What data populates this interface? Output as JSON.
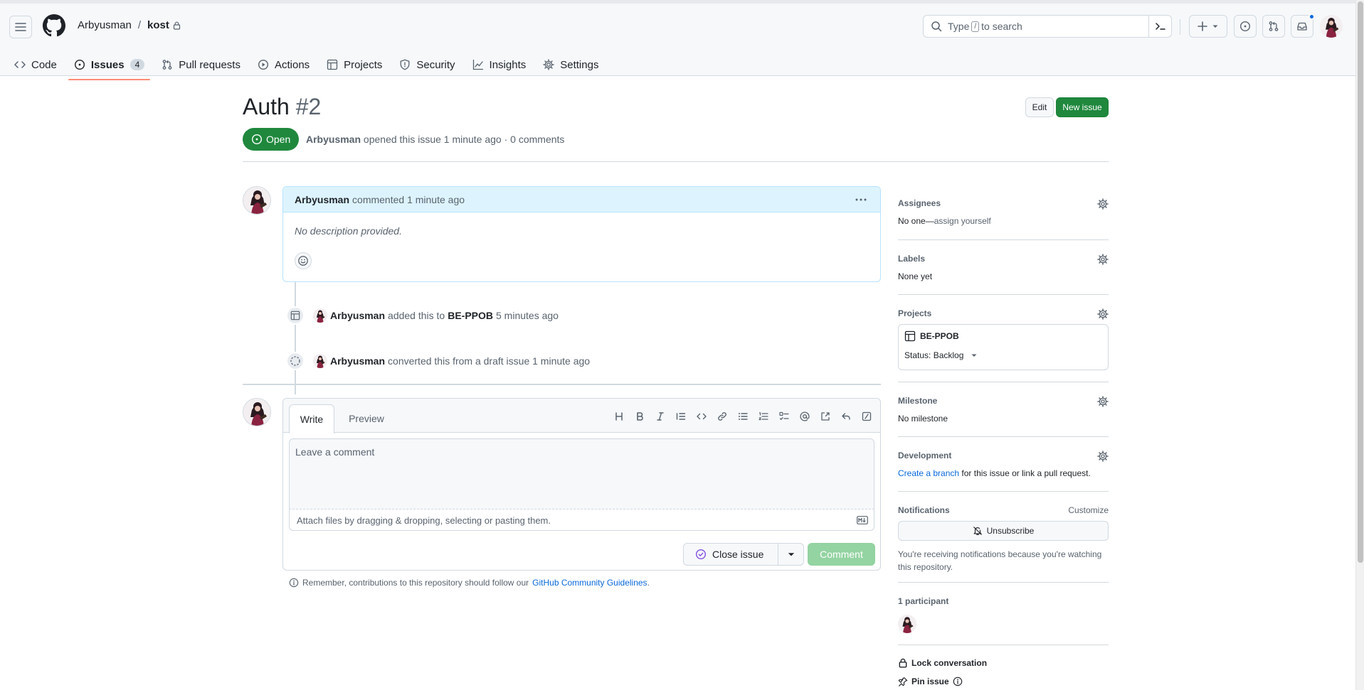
{
  "header": {
    "owner": "Arbyusman",
    "separator": "/",
    "repo": "kost",
    "search_prefix": "Type",
    "search_key": "/",
    "search_suffix": "to search"
  },
  "nav": {
    "code": "Code",
    "issues": "Issues",
    "issues_count": "4",
    "pulls": "Pull requests",
    "actions": "Actions",
    "projects": "Projects",
    "security": "Security",
    "insights": "Insights",
    "settings": "Settings"
  },
  "issue": {
    "title": "Auth",
    "number": "#2",
    "edit_label": "Edit",
    "new_issue_label": "New issue",
    "state": "Open",
    "author": "Arbyusman",
    "meta_text": "opened this issue 1 minute ago · 0 comments"
  },
  "comment": {
    "author": "Arbyusman",
    "action": "commented 1 minute ago",
    "body": "No description provided."
  },
  "events": [
    {
      "actor": "Arbyusman",
      "text": "added this to",
      "target": "BE-PPOB",
      "time": "5 minutes ago"
    },
    {
      "actor": "Arbyusman",
      "text": "converted this from a draft issue 1 minute ago"
    }
  ],
  "composer": {
    "tab_write": "Write",
    "tab_preview": "Preview",
    "placeholder": "Leave a comment",
    "attach_text": "Attach files by dragging & dropping, selecting or pasting them.",
    "close_label": "Close issue",
    "comment_label": "Comment",
    "guidelines_prefix": "Remember, contributions to this repository should follow our",
    "guidelines_link": "GitHub Community Guidelines",
    "guidelines_suffix": "."
  },
  "sidebar": {
    "assignees_title": "Assignees",
    "assignees_value": "No one—",
    "assignees_link": "assign yourself",
    "labels_title": "Labels",
    "labels_value": "None yet",
    "projects_title": "Projects",
    "project_name": "BE-PPOB",
    "project_status": "Status: Backlog",
    "milestone_title": "Milestone",
    "milestone_value": "No milestone",
    "development_title": "Development",
    "development_link": "Create a branch",
    "development_text": "for this issue or link a pull request.",
    "notifications_title": "Notifications",
    "notifications_customize": "Customize",
    "unsubscribe_label": "Unsubscribe",
    "notifications_note": "You're receiving notifications because you're watching this repository.",
    "participants_title": "1 participant",
    "lock_label": "Lock conversation",
    "pin_label": "Pin issue"
  },
  "colors": {
    "accent_green": "#1f883d",
    "link_blue": "#0969da",
    "nav_underline": "#fd8c73",
    "comment_header": "#ddf4ff"
  }
}
